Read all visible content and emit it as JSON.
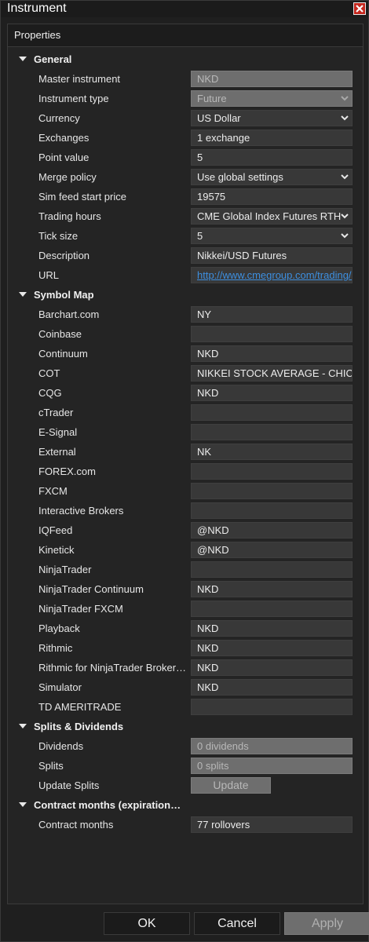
{
  "window": {
    "title": "Instrument"
  },
  "properties": {
    "header": "Properties",
    "categories": [
      {
        "label": "General",
        "rows": [
          {
            "label": "Master instrument",
            "value": "NKD",
            "kind": "disabled"
          },
          {
            "label": "Instrument type",
            "value": "Future",
            "kind": "disabled-dropdown"
          },
          {
            "label": "Currency",
            "value": "US Dollar",
            "kind": "dropdown"
          },
          {
            "label": "Exchanges",
            "value": "1 exchange",
            "kind": "text"
          },
          {
            "label": "Point value",
            "value": "5",
            "kind": "text"
          },
          {
            "label": "Merge policy",
            "value": "Use global settings",
            "kind": "dropdown"
          },
          {
            "label": "Sim feed start price",
            "value": "19575",
            "kind": "text"
          },
          {
            "label": "Trading hours",
            "value": "CME Global Index Futures RTH",
            "kind": "dropdown"
          },
          {
            "label": "Tick size",
            "value": "5",
            "kind": "dropdown"
          },
          {
            "label": "Description",
            "value": "Nikkei/USD Futures",
            "kind": "text"
          },
          {
            "label": "URL",
            "value": "http://www.cmegroup.com/trading/e",
            "kind": "link"
          }
        ]
      },
      {
        "label": "Symbol Map",
        "rows": [
          {
            "label": "Barchart.com",
            "value": "NY",
            "kind": "text"
          },
          {
            "label": "Coinbase",
            "value": "",
            "kind": "text"
          },
          {
            "label": "Continuum",
            "value": "NKD",
            "kind": "text"
          },
          {
            "label": "COT",
            "value": "NIKKEI STOCK AVERAGE - CHICA",
            "kind": "text"
          },
          {
            "label": "CQG",
            "value": "NKD",
            "kind": "text"
          },
          {
            "label": "cTrader",
            "value": "",
            "kind": "text"
          },
          {
            "label": "E-Signal",
            "value": "",
            "kind": "text"
          },
          {
            "label": "External",
            "value": "NK",
            "kind": "text"
          },
          {
            "label": "FOREX.com",
            "value": "",
            "kind": "text"
          },
          {
            "label": "FXCM",
            "value": "",
            "kind": "text"
          },
          {
            "label": "Interactive Brokers",
            "value": "",
            "kind": "text"
          },
          {
            "label": "IQFeed",
            "value": "@NKD",
            "kind": "text"
          },
          {
            "label": "Kinetick",
            "value": "@NKD",
            "kind": "text"
          },
          {
            "label": "NinjaTrader",
            "value": "",
            "kind": "text"
          },
          {
            "label": "NinjaTrader Continuum",
            "value": "NKD",
            "kind": "text"
          },
          {
            "label": "NinjaTrader FXCM",
            "value": "",
            "kind": "text"
          },
          {
            "label": "Playback",
            "value": "NKD",
            "kind": "text"
          },
          {
            "label": "Rithmic",
            "value": "NKD",
            "kind": "text"
          },
          {
            "label": "Rithmic for NinjaTrader Broker…",
            "value": "NKD",
            "kind": "text"
          },
          {
            "label": "Simulator",
            "value": "NKD",
            "kind": "text"
          },
          {
            "label": "TD AMERITRADE",
            "value": "",
            "kind": "text"
          }
        ]
      },
      {
        "label": "Splits & Dividends",
        "rows": [
          {
            "label": "Dividends",
            "value": "0 dividends",
            "kind": "disabled"
          },
          {
            "label": "Splits",
            "value": "0 splits",
            "kind": "disabled"
          },
          {
            "label": "Update Splits",
            "value": "Update",
            "kind": "button"
          }
        ]
      },
      {
        "label": "Contract months (expiration…",
        "rows": [
          {
            "label": "Contract months",
            "value": "77 rollovers",
            "kind": "text"
          }
        ]
      }
    ]
  },
  "footer": {
    "ok": "OK",
    "cancel": "Cancel",
    "apply": "Apply"
  },
  "icons": {
    "close": "close-icon",
    "collapse": "collapse-triangle-icon",
    "dropdown": "chevron-down-icon"
  },
  "colors": {
    "close_button": "#c4271e",
    "link": "#3d8fe0",
    "background": "#1f1f1f"
  }
}
